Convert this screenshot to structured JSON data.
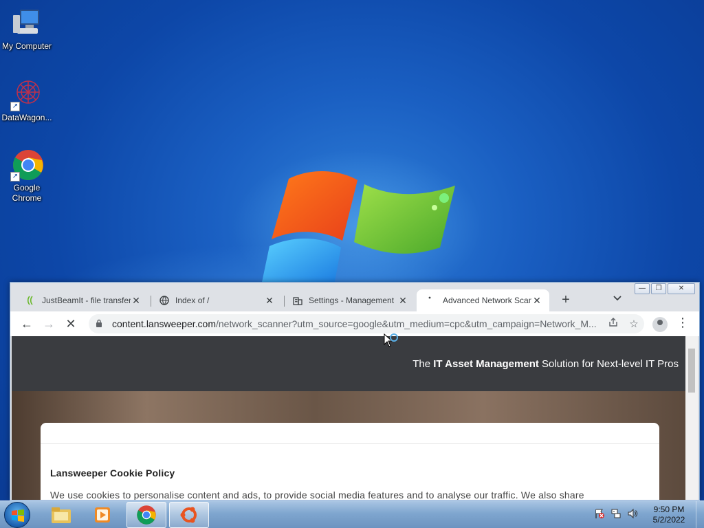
{
  "desktop": {
    "icons": [
      {
        "label": "My Computer",
        "icon": "computer-icon"
      },
      {
        "label": "DataWagon...",
        "icon": "datawagon-icon"
      },
      {
        "label": "Google\nChrome",
        "icon": "chrome-icon"
      }
    ]
  },
  "browser": {
    "tabs": [
      {
        "title": "JustBeamIt - file transfer",
        "icon": "justbeamit-icon",
        "close": "✕"
      },
      {
        "title": "Index of /",
        "icon": "globe-icon",
        "close": "✕"
      },
      {
        "title": "Settings - Management",
        "icon": "building-icon",
        "close": "✕"
      },
      {
        "title": "Advanced Network Scanner",
        "icon": "loading-icon",
        "close": "✕"
      }
    ],
    "new_tab": "+",
    "tab_search": "⌄",
    "window_controls": {
      "minimize": "—",
      "restore": "❐",
      "close": "✕"
    },
    "nav": {
      "back": "←",
      "forward": "→",
      "stop": "✕"
    },
    "url_domain": "content.lansweeper.com",
    "url_path": "/network_scanner?utm_source=google&utm_medium=cpc&utm_campaign=Network_M...",
    "lock_icon": "🔒",
    "share_icon": "⇪",
    "bookmark_icon": "☆",
    "menu_icon": "⋮"
  },
  "page": {
    "header_prefix": "The ",
    "header_bold": "IT Asset Management",
    "header_suffix": " Solution for Next-level IT Pros",
    "cookie_title": "Lansweeper Cookie Policy",
    "cookie_text": "We use cookies to personalise content and ads, to provide social media features and to analyse our traffic. We also share"
  },
  "taskbar": {
    "items": [
      "explorer-icon",
      "media-player-icon",
      "chrome-icon",
      "ubuntu-icon"
    ],
    "time": "9:50 PM",
    "date": "5/2/2022"
  }
}
